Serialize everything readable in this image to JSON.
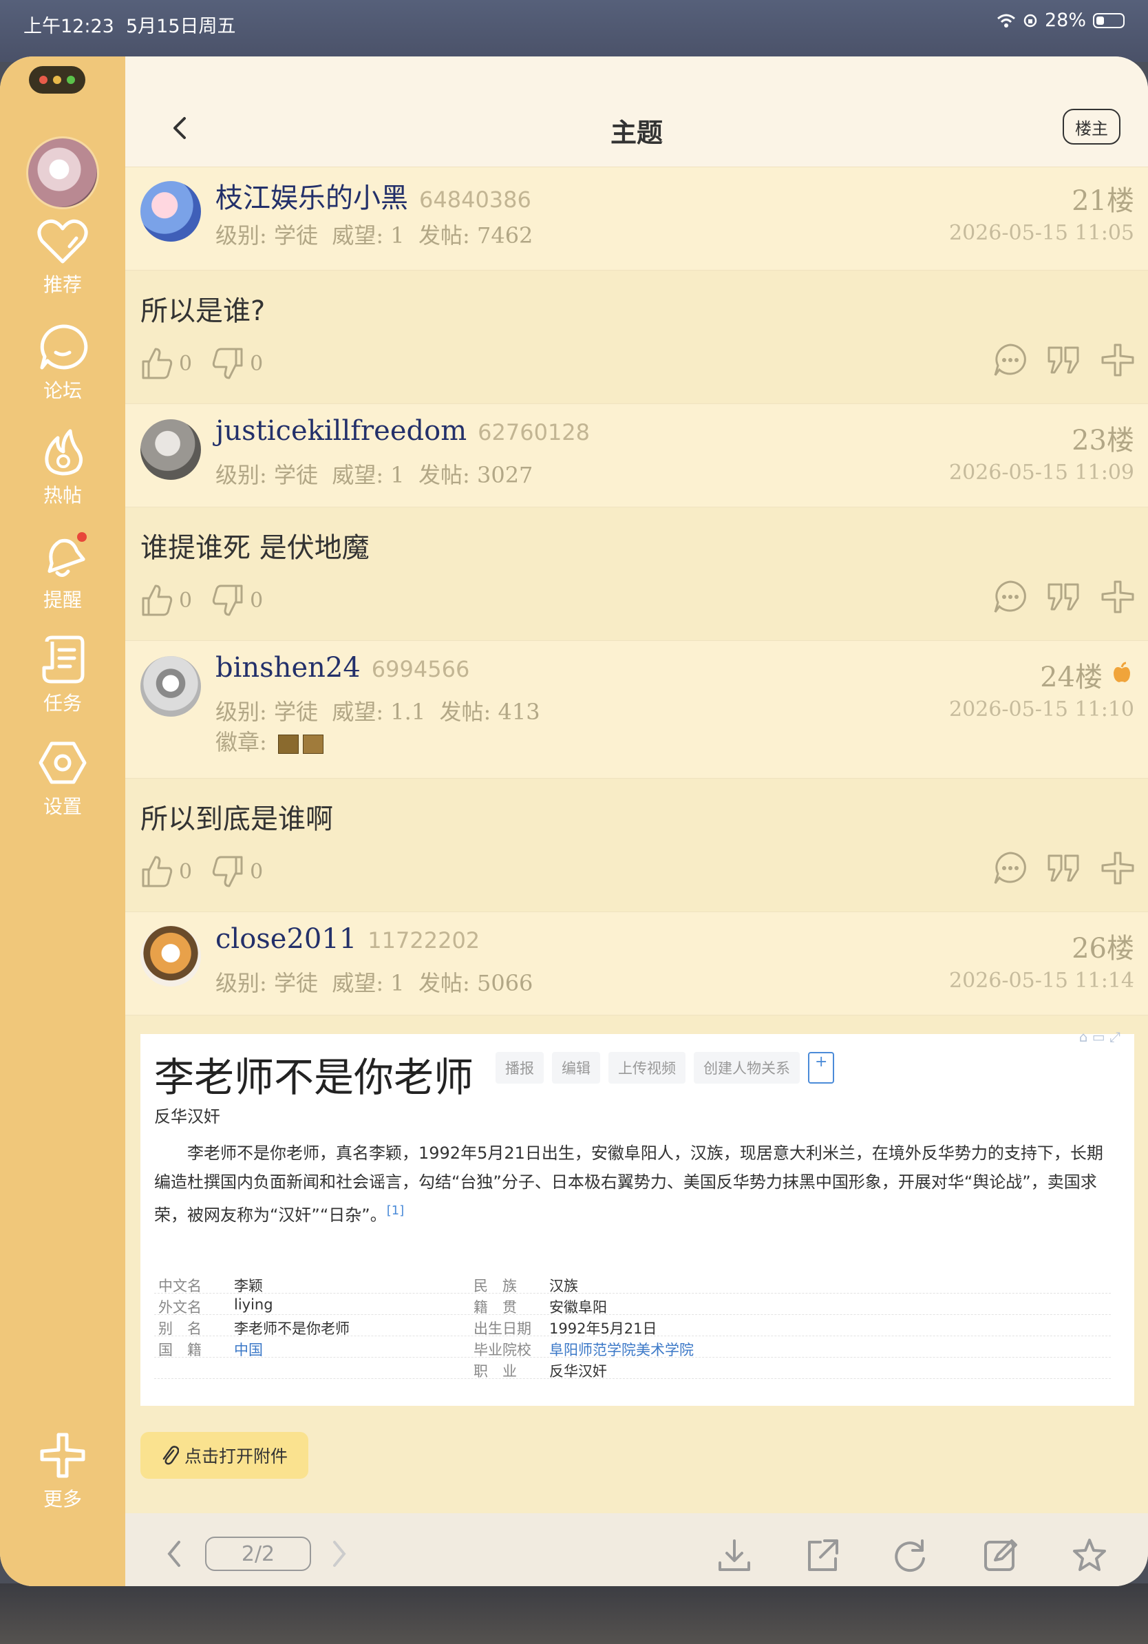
{
  "status_bar": {
    "time": "上午12:23",
    "date": "5月15日周五",
    "battery": "28%"
  },
  "sidebar": {
    "items": [
      {
        "label": "推荐",
        "icon": "heart-icon"
      },
      {
        "label": "论坛",
        "icon": "chat-bubble-icon"
      },
      {
        "label": "热帖",
        "icon": "fire-icon"
      },
      {
        "label": "提醒",
        "icon": "bell-icon",
        "has_dot": true
      },
      {
        "label": "任务",
        "icon": "task-list-icon"
      },
      {
        "label": "设置",
        "icon": "gear-icon"
      },
      {
        "label": "更多",
        "icon": "plus-icon"
      }
    ]
  },
  "header": {
    "title": "主题",
    "owner_button": "楼主"
  },
  "meta_labels": {
    "level": "级别:",
    "prestige": "威望:",
    "posts": "发帖:",
    "medals": "徽章:"
  },
  "posts": [
    {
      "username": "枝江娱乐的小黑",
      "uid": "64840386",
      "level": "学徒",
      "prestige": "1",
      "post_count": "7462",
      "floor": "21楼",
      "date": "2026-05-15 11:05",
      "content": "所以是谁?",
      "likes": "0",
      "dislikes": "0"
    },
    {
      "username": "justicekillfreedom",
      "uid": "62760128",
      "level": "学徒",
      "prestige": "1",
      "post_count": "3027",
      "floor": "23楼",
      "date": "2026-05-15 11:09",
      "content": "谁提谁死 是伏地魔",
      "likes": "0",
      "dislikes": "0"
    },
    {
      "username": "binshen24",
      "uid": "6994566",
      "level": "学徒",
      "prestige": "1.1",
      "post_count": "413",
      "floor": "24楼",
      "date": "2026-05-15 11:10",
      "content": "所以到底是谁啊",
      "likes": "0",
      "dislikes": "0"
    },
    {
      "username": "close2011",
      "uid": "11722202",
      "level": "学徒",
      "prestige": "1",
      "post_count": "5066",
      "floor": "26楼",
      "date": "2026-05-15 11:14"
    }
  ],
  "embed": {
    "title": "李老师不是你老师",
    "tools": [
      "播报",
      "编辑",
      "上传视频",
      "创建人物关系"
    ],
    "subtitle": "反华汉奸",
    "paragraph": "李老师不是你老师，真名李颖，1992年5月21日出生，安徽阜阳人，汉族，现居意大利米兰，在境外反华势力的支持下，长期编造杜撰国内负面新闻和社会谣言，勾结“台独”分子、日本极右翼势力、美国反华势力抹黑中国形象，开展对华“舆论战”，卖国求荣，被网友称为“汉奸”“日杂”。",
    "ref": "[1]",
    "info_left": [
      {
        "key": "中文名",
        "value": "李颖"
      },
      {
        "key": "外文名",
        "value": "liying"
      },
      {
        "key": "别　名",
        "value": "李老师不是你老师"
      },
      {
        "key": "国　籍",
        "value": "中国"
      }
    ],
    "info_right": [
      {
        "key": "民　族",
        "value": "汉族"
      },
      {
        "key": "籍　贯",
        "value": "安徽阜阳"
      },
      {
        "key": "出生日期",
        "value": "1992年5月21日"
      },
      {
        "key": "毕业院校",
        "value": "阜阳师范学院美术学院"
      },
      {
        "key": "职　业",
        "value": "反华汉奸"
      }
    ]
  },
  "attachment_button": "点击打开附件",
  "bottom_bar": {
    "page": "2/2"
  },
  "colors": {
    "sidebar": "#f0c77a",
    "username": "#23306a",
    "meta": "#b2a786",
    "attach": "#fae28f"
  }
}
